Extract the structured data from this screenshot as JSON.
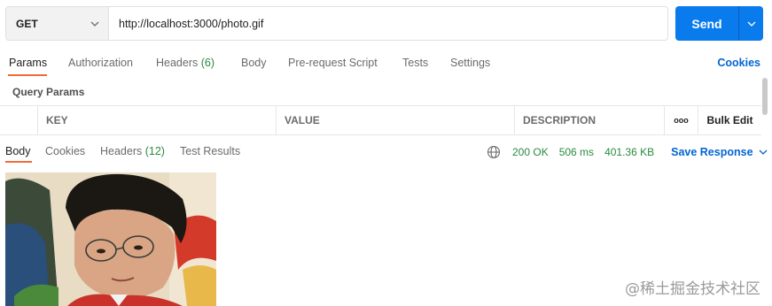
{
  "request": {
    "method": "GET",
    "url": "http://localhost:3000/photo.gif",
    "send_label": "Send"
  },
  "request_tabs": {
    "params": "Params",
    "authorization": "Authorization",
    "headers": "Headers",
    "headers_count": "(6)",
    "body": "Body",
    "pre_request": "Pre-request Script",
    "tests": "Tests",
    "settings": "Settings",
    "cookies": "Cookies"
  },
  "query_params": {
    "title": "Query Params",
    "columns": {
      "key": "KEY",
      "value": "VALUE",
      "description": "DESCRIPTION"
    },
    "more": "ooo",
    "bulk_edit": "Bulk Edit"
  },
  "response_tabs": {
    "body": "Body",
    "cookies": "Cookies",
    "headers": "Headers",
    "headers_count": "(12)",
    "test_results": "Test Results"
  },
  "response_status": {
    "status": "200 OK",
    "time": "506 ms",
    "size": "401.36 KB",
    "save_label": "Save Response"
  },
  "colors": {
    "send": "#097bed",
    "accent_tab": "#f26b3a",
    "link": "#0265d2",
    "status_ok": "#2b8a3e"
  },
  "icons": {
    "method_dropdown": "chevron-down-icon",
    "send_dropdown": "chevron-down-icon",
    "network": "globe-icon",
    "save_dropdown": "chevron-down-icon"
  },
  "watermark": "@稀土掘金技术社区"
}
